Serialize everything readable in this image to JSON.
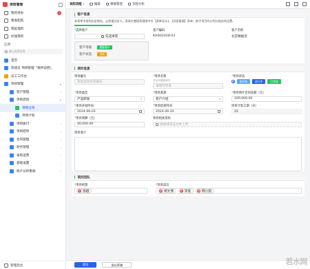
{
  "app": {
    "title": "项目管理"
  },
  "sidebar": {
    "top_items": [
      {
        "label": "我的待办",
        "badge": "7"
      },
      {
        "label": "我发起的"
      },
      {
        "label": "我处理的"
      },
      {
        "label": "抄送我的"
      }
    ],
    "section_label": "应用",
    "search_placeholder": "输入应用名称",
    "items": [
      {
        "label": "首页"
      },
      {
        "label": "简道云 项目管理「教师说明」"
      },
      {
        "label": "员工工作台"
      },
      {
        "label": "项目管理"
      },
      {
        "label": "客户管理"
      },
      {
        "label": "项目启动"
      },
      {
        "label": "项目立项"
      },
      {
        "label": "项目计划"
      },
      {
        "label": "项目执行"
      },
      {
        "label": "项目结项"
      },
      {
        "label": "合同管理"
      },
      {
        "label": "财务管理"
      },
      {
        "label": "采购运营"
      },
      {
        "label": "基础设置"
      },
      {
        "label": "统计分析看板"
      }
    ],
    "footer": "管理后台"
  },
  "toolbar": {
    "main": "发起流程",
    "edit": "编辑",
    "data_mgmt": "数据管理",
    "flow_analysis": "流程分析"
  },
  "customer_section": {
    "title": "客户信息",
    "hint": "本表单字段的比定制化，立即通过定义。直接在整理表视图中在【表单设计】，【页面管理】表单，联手项目的计划与相应的设置。",
    "select_label": "选择客户",
    "select_value": "先选择管",
    "code_label": "客户编码",
    "code_value": "KHD42028-03",
    "name_label": "客户名称",
    "name_value": "北京数据云",
    "level_label": "客户等级",
    "level_value": "重要客户",
    "status_label": "客户状态",
    "status_value": "活跃"
  },
  "project_section": {
    "title": "项目信息",
    "code_label": "项目编号",
    "code_placeholder": "系统自动生成编号",
    "name_label": "项目名称",
    "name_sub": "不允许重复填写",
    "name_placeholder": "请填写项目",
    "status_label": "项目状态",
    "status_options": [
      "未开始",
      "进行中",
      "已完成"
    ],
    "type_label": "项目类型",
    "type_value": "产品研发",
    "source_label": "项目来源",
    "source_value": "客户介绍",
    "amount_label": "项目预计合同金额（元）",
    "amount_value": "100,000.00",
    "start_label": "项目开始时间",
    "start_value": "2024-06-03",
    "end_label": "项目结束时间",
    "end_value": "2024-06-20",
    "days_label": "项目计划工期（天）",
    "days_value": "25",
    "budget_label": "项目预算（元）",
    "budget_value": "40,000.00",
    "attach_label": "项目相关资料",
    "attach_value": "拖拽或点击文件上传",
    "intro_label": "项目简介"
  },
  "team_section": {
    "title": "项目团队",
    "manager_label": "项目经理",
    "manager": {
      "name": "张越",
      "initial": "张"
    },
    "members_label": "项目成员",
    "members": [
      {
        "name": "郑文博",
        "initial": "郑"
      },
      {
        "name": "李俊",
        "initial": "李"
      },
      {
        "name": "韩小丽",
        "initial": "韩"
      }
    ]
  },
  "footer": {
    "submit": "提交",
    "draft": "保存草稿"
  },
  "watermark": "若水网",
  "colors": {
    "accent": "#2563eb",
    "success": "#22c55e",
    "warning": "#f59e0b",
    "danger": "#ef4444"
  },
  "icons": {
    "app_logo": "app-logo-icon",
    "search": "search-icon",
    "calendar": "calendar-icon"
  }
}
